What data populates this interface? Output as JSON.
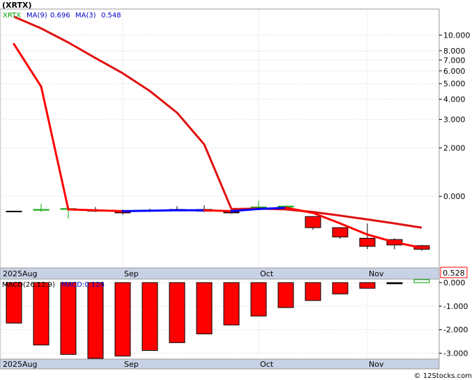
{
  "header": {
    "symbol": "(XRTX)",
    "ma9_label": "MA(9)",
    "ma9_value": "0.696",
    "ma3_label": "MA(3)",
    "ma3_value": "0.548",
    "last_price": "0.528"
  },
  "macd_header": {
    "label": "MACD(26,12,9)",
    "value_label": "MACD:0.126"
  },
  "footer": {
    "watermark": "© 12Stocks.com"
  },
  "colors": {
    "up": "#00a000",
    "down": "#ff0000",
    "ma_long": "#e01010",
    "ma_short_up": "#0000ff",
    "ma_short_down": "#ff0000",
    "header_symbol": "#000000",
    "header_ma": "#0000cc",
    "axis_band": "#c8d2e6",
    "grid": "#c8c8c8"
  },
  "chart_data": [
    {
      "type": "candlestick",
      "y_scale": "log",
      "ylim": [
        0.36,
        14.5
      ],
      "y_ticks": [
        {
          "value": 10,
          "label": "10.000"
        },
        {
          "value": 8,
          "label": "8.000"
        },
        {
          "value": 7,
          "label": "7.000"
        },
        {
          "value": 6,
          "label": "6.000"
        },
        {
          "value": 5,
          "label": "5.000"
        },
        {
          "value": 4,
          "label": "4.000"
        },
        {
          "value": 3,
          "label": "3.000"
        },
        {
          "value": 2,
          "label": "2.000"
        },
        {
          "value": 1,
          "label": "0.000"
        }
      ],
      "x_labels": [
        {
          "index": 0,
          "label": "2025Aug"
        },
        {
          "index": 4,
          "label": "Sep"
        },
        {
          "index": 9,
          "label": "Oct"
        },
        {
          "index": 13,
          "label": "Nov"
        }
      ],
      "candles": [
        {
          "open": 0.81,
          "high": 0.81,
          "low": 0.81,
          "close": 0.81,
          "dir": "flat"
        },
        {
          "open": 0.82,
          "high": 0.9,
          "low": 0.8,
          "close": 0.83,
          "dir": "up"
        },
        {
          "open": 0.83,
          "high": 0.85,
          "low": 0.73,
          "close": 0.84,
          "dir": "up"
        },
        {
          "open": 0.82,
          "high": 0.86,
          "low": 0.8,
          "close": 0.81,
          "dir": "down"
        },
        {
          "open": 0.81,
          "high": 0.83,
          "low": 0.77,
          "close": 0.79,
          "dir": "down"
        },
        {
          "open": 0.82,
          "high": 0.84,
          "low": 0.8,
          "close": 0.82,
          "dir": "down"
        },
        {
          "open": 0.83,
          "high": 0.87,
          "low": 0.81,
          "close": 0.83,
          "dir": "down"
        },
        {
          "open": 0.83,
          "high": 0.88,
          "low": 0.8,
          "close": 0.81,
          "dir": "down"
        },
        {
          "open": 0.8,
          "high": 0.84,
          "low": 0.78,
          "close": 0.79,
          "dir": "down"
        },
        {
          "open": 0.85,
          "high": 0.94,
          "low": 0.84,
          "close": 0.86,
          "dir": "up"
        },
        {
          "open": 0.86,
          "high": 0.88,
          "low": 0.84,
          "close": 0.87,
          "dir": "up"
        },
        {
          "open": 0.75,
          "high": 0.75,
          "low": 0.62,
          "close": 0.64,
          "dir": "down"
        },
        {
          "open": 0.64,
          "high": 0.64,
          "low": 0.545,
          "close": 0.56,
          "dir": "down"
        },
        {
          "open": 0.55,
          "high": 0.68,
          "low": 0.47,
          "close": 0.49,
          "dir": "down"
        },
        {
          "open": 0.54,
          "high": 0.55,
          "low": 0.47,
          "close": 0.5,
          "dir": "down"
        },
        {
          "open": 0.495,
          "high": 0.5,
          "low": 0.46,
          "close": 0.47,
          "dir": "down"
        }
      ],
      "series": [
        {
          "name": "MA(9)",
          "values": [
            13.0,
            11.0,
            9.0,
            7.2,
            5.8,
            4.5,
            3.3,
            2.1,
            0.835,
            0.84,
            0.83,
            0.8,
            0.76,
            0.72,
            0.68,
            0.64
          ]
        },
        {
          "name": "MA(3)",
          "values": [
            8.8,
            4.8,
            0.83,
            0.82,
            0.81,
            0.815,
            0.82,
            0.82,
            0.81,
            0.835,
            0.85,
            0.79,
            0.68,
            0.58,
            0.52,
            0.48
          ]
        }
      ]
    },
    {
      "type": "bar",
      "title": "MACD(26,12,9)",
      "ylim": [
        -3.25,
        0.15
      ],
      "y_ticks": [
        {
          "value": 0,
          "label": "0.000"
        },
        {
          "value": -1,
          "label": "-1.000"
        },
        {
          "value": -2,
          "label": "-2.000"
        },
        {
          "value": -3,
          "label": "-3.000"
        }
      ],
      "x_labels": [
        {
          "index": 0,
          "label": "2025Aug"
        },
        {
          "index": 4,
          "label": "Sep"
        },
        {
          "index": 9,
          "label": "Oct"
        },
        {
          "index": 13,
          "label": "Nov"
        }
      ],
      "values": [
        -1.72,
        -2.65,
        -3.05,
        -3.22,
        -3.12,
        -2.88,
        -2.55,
        -2.18,
        -1.8,
        -1.42,
        -1.06,
        -0.76,
        -0.48,
        -0.24,
        -0.05,
        0.126
      ]
    }
  ]
}
